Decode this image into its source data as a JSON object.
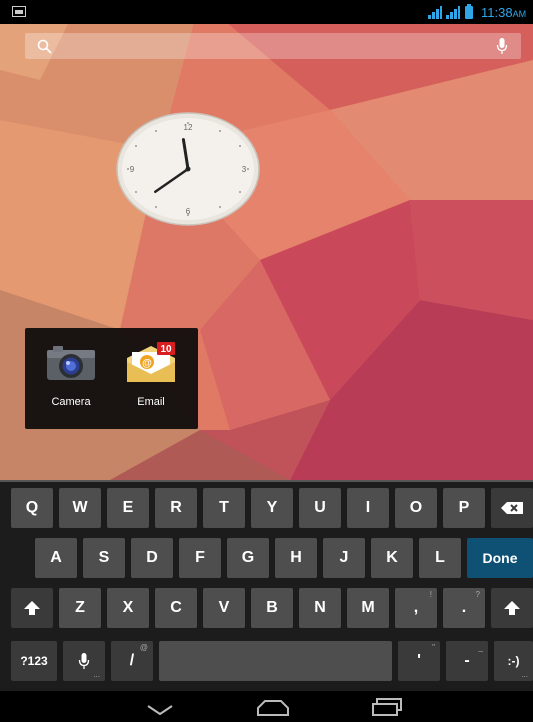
{
  "status_bar": {
    "time": "11:38",
    "ampm": "AM",
    "accent_color": "#2fa6e8",
    "icons": [
      "image-notification-icon",
      "signal-icon",
      "signal-icon",
      "battery-icon"
    ]
  },
  "search_bar": {
    "icons": [
      "search-icon",
      "mic-icon"
    ]
  },
  "clock_widget": {
    "numerals": [
      "12",
      "3",
      "6",
      "9"
    ],
    "hour": 11,
    "minute": 38
  },
  "folder": {
    "apps": [
      {
        "label": "Camera",
        "icon": "camera-icon"
      },
      {
        "label": "Email",
        "icon": "email-icon",
        "badge": "10"
      }
    ]
  },
  "keyboard": {
    "row1": [
      "Q",
      "W",
      "E",
      "R",
      "T",
      "Y",
      "U",
      "I",
      "O",
      "P"
    ],
    "row2": [
      "A",
      "S",
      "D",
      "F",
      "G",
      "H",
      "J",
      "K",
      "L"
    ],
    "row3": [
      "Z",
      "X",
      "C",
      "V",
      "B",
      "N",
      "M",
      ",",
      "."
    ],
    "row3_hints": [
      "!",
      "?"
    ],
    "done_label": "Done",
    "symbols_label": "?123",
    "slash_label": "/",
    "slash_hint": "@",
    "apostrophe_label": "'",
    "apostrophe_hint": "\"",
    "dash_label": "-",
    "dash_hint": "_",
    "smiley_label": ":-)",
    "dots": "...",
    "icons": [
      "backspace-icon",
      "shift-icon",
      "mic-icon"
    ]
  },
  "nav_bar": {
    "icons": [
      "back-icon",
      "home-icon",
      "recents-icon"
    ]
  }
}
